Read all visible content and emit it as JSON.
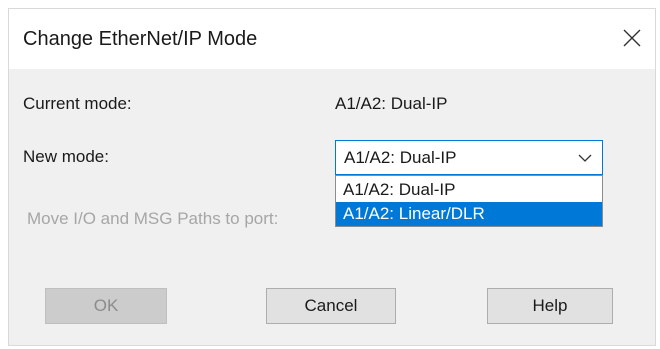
{
  "dialog": {
    "title": "Change EtherNet/IP Mode",
    "close_icon": "close-icon"
  },
  "current_mode": {
    "label": "Current mode:",
    "value": "A1/A2: Dual-IP"
  },
  "new_mode": {
    "label": "New mode:",
    "selected": "A1/A2: Dual-IP",
    "options": [
      "A1/A2: Dual-IP",
      "A1/A2: Linear/DLR"
    ],
    "highlighted_option": "A1/A2: Linear/DLR",
    "chevron_icon": "chevron-down-icon"
  },
  "move_paths": {
    "label": "Move I/O and MSG Paths to port:"
  },
  "buttons": {
    "ok": "OK",
    "cancel": "Cancel",
    "help": "Help"
  },
  "colors": {
    "accent": "#0078d7",
    "dialog_bg": "#f0f0f0",
    "disabled_text": "#a6a6a6"
  }
}
